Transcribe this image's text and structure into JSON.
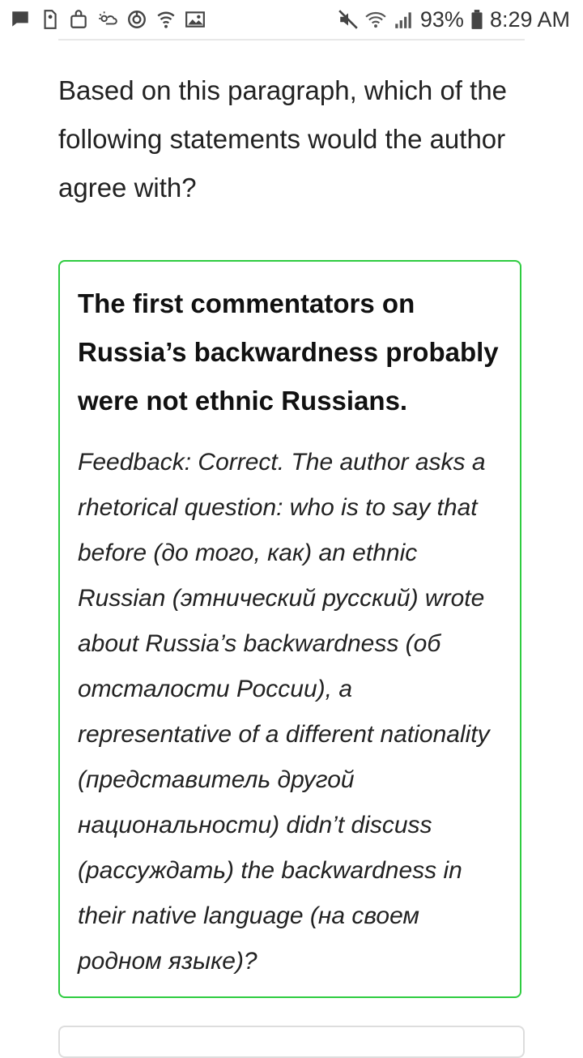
{
  "status_bar": {
    "left_icons": [
      "message-icon",
      "sim-icon",
      "bag-icon",
      "weather-icon",
      "sync-icon",
      "wifi-call-icon",
      "image-icon"
    ],
    "right_icons": [
      "mute-icon",
      "wifi-icon",
      "signal-icon",
      "battery-icon"
    ],
    "battery": "93%",
    "time": "8:29 AM"
  },
  "question": {
    "text": "Based on this paragraph, which of the following statements would the author agree with?"
  },
  "answer": {
    "status": "correct",
    "border_color": "#2ecc40",
    "title": "The first commentators on Russia’s backwardness probably were not ethnic Russians.",
    "feedback": "Feedback: Correct. The author asks a rhetorical question: who is to say that before (до того, как) an ethnic Russian (этнический русский) wrote about Russia’s backwardness (об отсталости России), a representative of a different nationality (представитель другой национальности) didn’t discuss (рассуждать) the backwardness in their native language (на своем родном языке)?"
  }
}
